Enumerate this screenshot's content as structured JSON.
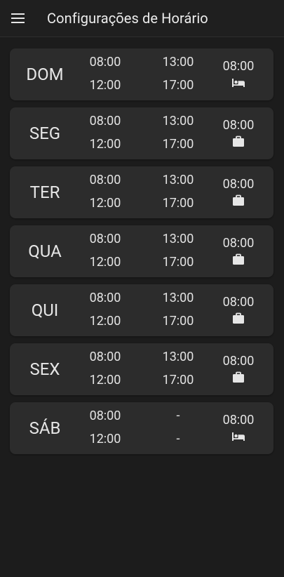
{
  "appbar": {
    "title": "Configurações de Horário",
    "menu_icon": "menu-icon"
  },
  "days": [
    {
      "day": "DOM",
      "morning_start": "08:00",
      "morning_end": "12:00",
      "afternoon_start": "13:00",
      "afternoon_end": "17:00",
      "extra": "08:00",
      "icon": "bed-icon"
    },
    {
      "day": "SEG",
      "morning_start": "08:00",
      "morning_end": "12:00",
      "afternoon_start": "13:00",
      "afternoon_end": "17:00",
      "extra": "08:00",
      "icon": "briefcase-icon"
    },
    {
      "day": "TER",
      "morning_start": "08:00",
      "morning_end": "12:00",
      "afternoon_start": "13:00",
      "afternoon_end": "17:00",
      "extra": "08:00",
      "icon": "briefcase-icon"
    },
    {
      "day": "QUA",
      "morning_start": "08:00",
      "morning_end": "12:00",
      "afternoon_start": "13:00",
      "afternoon_end": "17:00",
      "extra": "08:00",
      "icon": "briefcase-icon"
    },
    {
      "day": "QUI",
      "morning_start": "08:00",
      "morning_end": "12:00",
      "afternoon_start": "13:00",
      "afternoon_end": "17:00",
      "extra": "08:00",
      "icon": "briefcase-icon"
    },
    {
      "day": "SEX",
      "morning_start": "08:00",
      "morning_end": "12:00",
      "afternoon_start": "13:00",
      "afternoon_end": "17:00",
      "extra": "08:00",
      "icon": "briefcase-icon"
    },
    {
      "day": "SÁB",
      "morning_start": "08:00",
      "morning_end": "12:00",
      "afternoon_start": "-",
      "afternoon_end": "-",
      "extra": "08:00",
      "icon": "bed-icon"
    }
  ],
  "colors": {
    "background": "#1c1c1c",
    "card": "#2c2c2c",
    "text": "#e6e6e6"
  }
}
